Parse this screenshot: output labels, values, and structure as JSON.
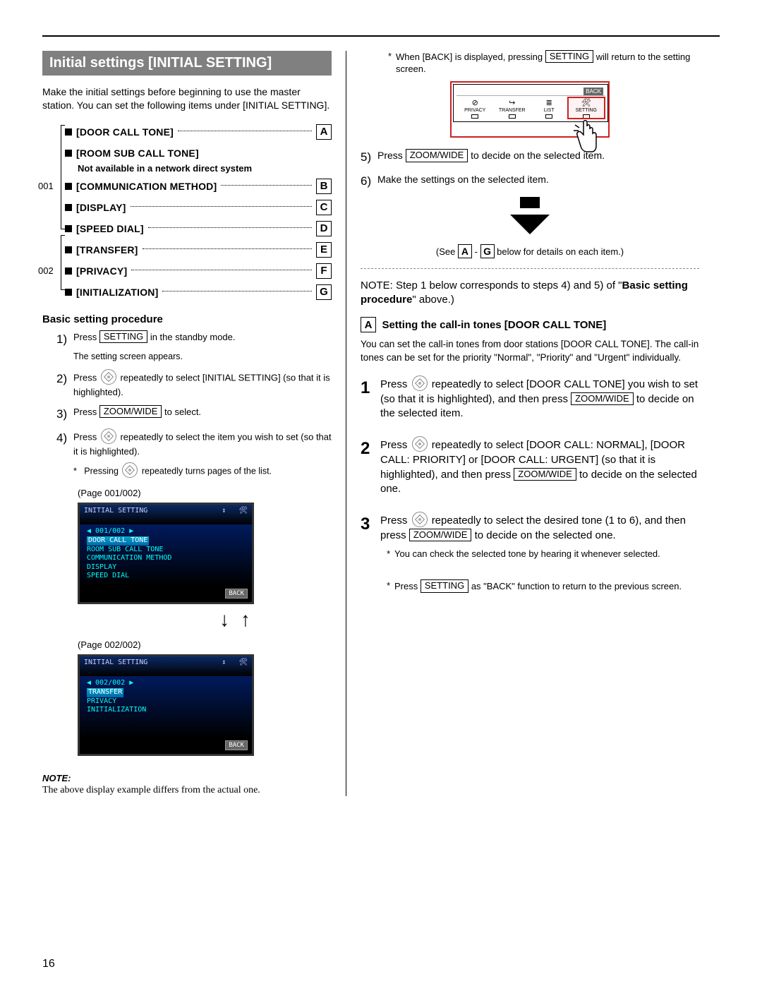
{
  "page_number": "16",
  "section_header": "Initial settings [INITIAL SETTING]",
  "intro": "Make the initial settings before beginning to use the master station. You can set the following items under [INITIAL SETTING].",
  "settings_pages": {
    "p1": "001",
    "p2": "002"
  },
  "settings": {
    "a": {
      "label": "[DOOR CALL TONE]",
      "letter": "A"
    },
    "b_label": "[ROOM SUB CALL TONE]",
    "b_sub": "Not available in a network direct system",
    "c": {
      "label": "[COMMUNICATION METHOD]",
      "letter": "B"
    },
    "d": {
      "label": "[DISPLAY]",
      "letter": "C"
    },
    "e": {
      "label": "[SPEED DIAL]",
      "letter": "D"
    },
    "f": {
      "label": "[TRANSFER]",
      "letter": "E"
    },
    "g": {
      "label": "[PRIVACY]",
      "letter": "F"
    },
    "h": {
      "label": "[INITIALIZATION]",
      "letter": "G"
    }
  },
  "basic_heading": "Basic setting procedure",
  "keys": {
    "setting": "SETTING",
    "zoomwide": "ZOOM/WIDE"
  },
  "steps_left": {
    "s1a": "Press ",
    "s1b": " in the standby mode.",
    "s1_sub": "The setting screen appears.",
    "s2a": "Press ",
    "s2b": " repeatedly to select [INITIAL SETTING] (so that it is highlighted).",
    "s3a": "Press ",
    "s3b": " to select.",
    "s4a": "Press ",
    "s4b": " repeatedly to select the item you wish to set (so that it is highlighted).",
    "s4_star": "Pressing ",
    "s4_star2": " repeatedly turns pages of the list."
  },
  "screen1_caption": "(Page 001/002)",
  "screen2_caption": "(Page 002/002)",
  "lcd1": {
    "title": "INITIAL SETTING",
    "page": "◀ 001/002 ▶",
    "sel": "DOOR CALL TONE",
    "l1": "ROOM SUB CALL TONE",
    "l2": "COMMUNICATION METHOD",
    "l3": "DISPLAY",
    "l4": "SPEED DIAL",
    "back": "BACK"
  },
  "lcd2": {
    "title": "INITIAL SETTING",
    "page": "◀ 002/002 ▶",
    "sel": "TRANSFER",
    "l1": "PRIVACY",
    "l2": "INITIALIZATION",
    "back": "BACK"
  },
  "arrows_updown": "↓ ↑",
  "note_heading": "NOTE:",
  "note_body": "The above display example differs from the actual one.",
  "right": {
    "back_note_a": "When [BACK] is displayed, pressing ",
    "back_note_b": " will return to the setting screen.",
    "panel": {
      "back": "BACK",
      "b1": "PRIVACY",
      "b2": "TRANSFER",
      "b3": "LIST",
      "b4": "SETTING"
    },
    "s5a": "Press ",
    "s5b": " to decide on the selected item.",
    "s6": "Make the settings on the selected item.",
    "see_a": "(See ",
    "see_b": " - ",
    "see_c": " below for details on each item.)",
    "see_A": "A",
    "see_G": "G",
    "note2_a": "NOTE: Step 1 below corresponds to steps 4) and 5) of \"",
    "note2_b": "Basic setting procedure",
    "note2_c": "\" above.)",
    "sectA_heading": "Setting the call-in tones [DOOR CALL TONE]",
    "sectA_letter": "A",
    "sectA_intro": "You can set the call-in tones from door stations [DOOR CALL TONE]. The call-in tones can be set for the priority \"Normal\", \"Priority\" and \"Urgent\" individually.",
    "r1_a": "Press ",
    "r1_b": " repeatedly to select [DOOR CALL TONE] you wish to set (so that it is highlighted), and then press ",
    "r1_c": " to decide on the selected item.",
    "r2_a": "Press ",
    "r2_b": " repeatedly to select [DOOR CALL: NORMAL], [DOOR CALL: PRIORITY] or [DOOR CALL: URGENT] (so that it is highlighted), and then press ",
    "r2_c": " to decide on the selected one.",
    "r3_a": "Press ",
    "r3_b": " repeatedly to select the desired tone (1 to 6), and then press ",
    "r3_c": " to decide on the selected one.",
    "r3_star": "You can check the selected tone by hearing it whenever selected.",
    "r_final_a": "Press ",
    "r_final_b": " as \"BACK\" function to return to the previous screen."
  }
}
